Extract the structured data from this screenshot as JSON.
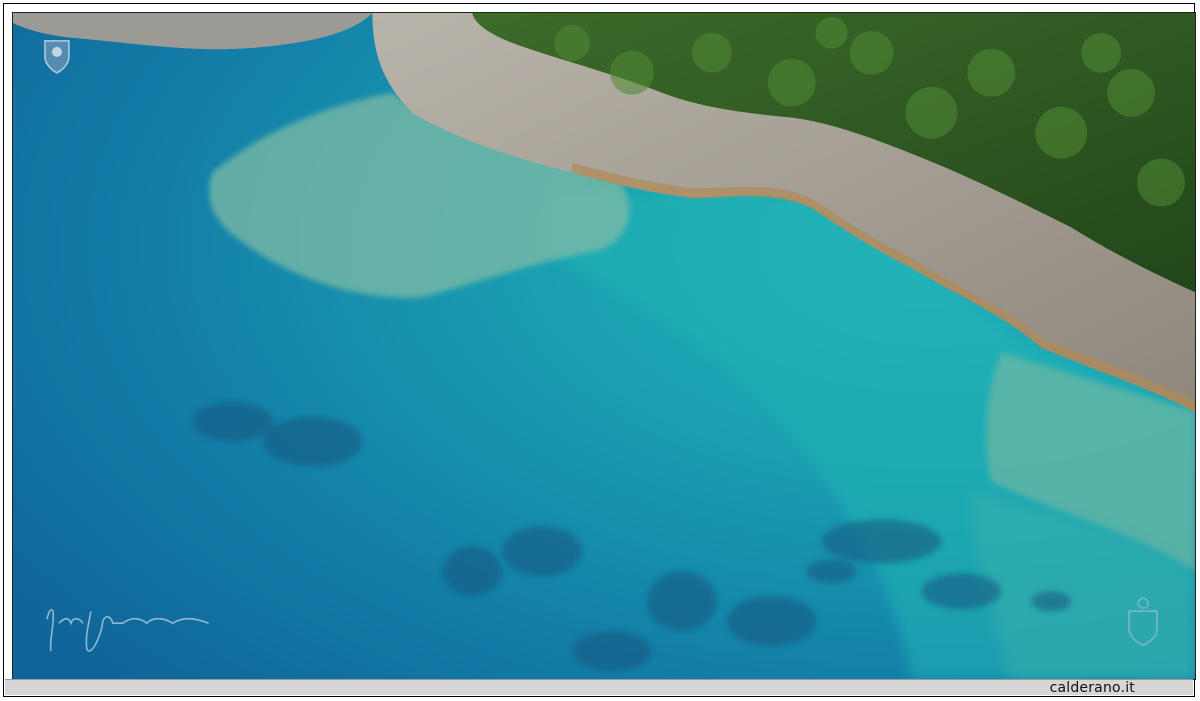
{
  "footer": {
    "site": "calderano.it"
  },
  "photo": {
    "subject": "aerial-coastline",
    "colors": {
      "deep_sea": "#126f9e",
      "shallow_sea": "#1ba7b0",
      "reef": "#8fbfa8",
      "rock": "#a9a39a",
      "forest": "#2f5a22"
    }
  },
  "watermarks": {
    "logo_top_left": "crest-icon",
    "logo_bottom_right": "crest-icon",
    "signature": "signature"
  }
}
